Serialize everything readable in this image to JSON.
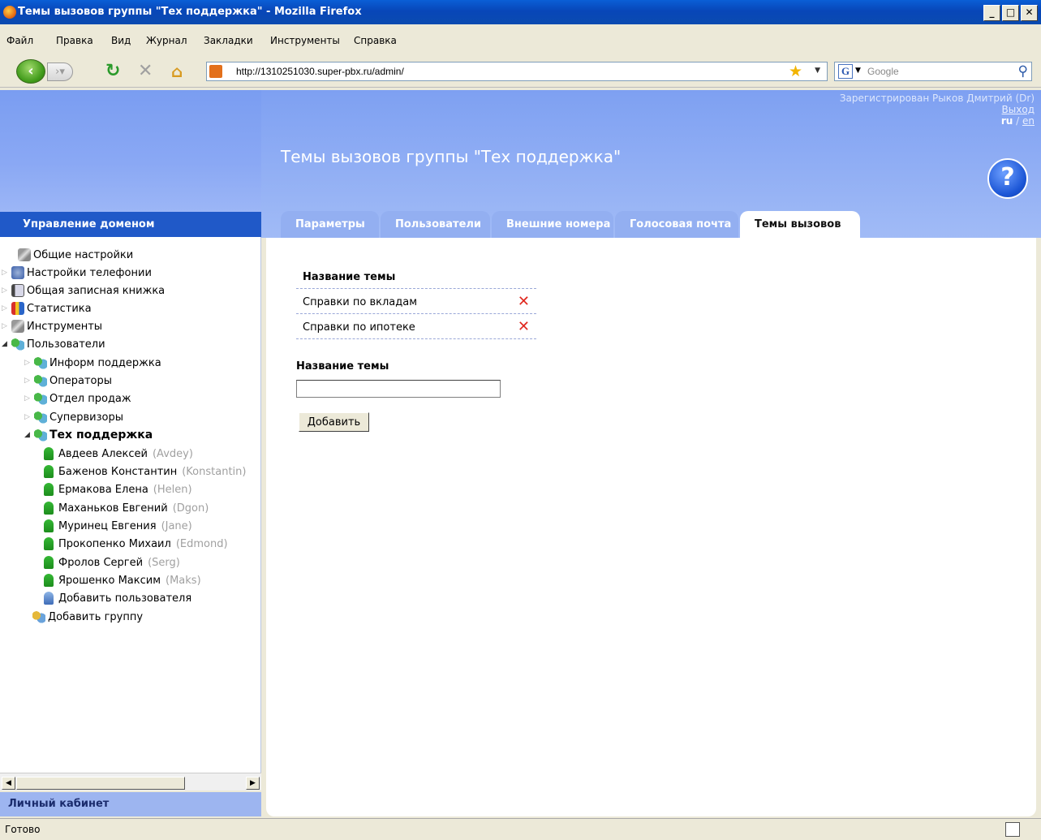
{
  "window": {
    "title": "Темы вызовов группы \"Тех поддержка\" - Mozilla Firefox"
  },
  "menu": [
    "Файл",
    "Правка",
    "Вид",
    "Журнал",
    "Закладки",
    "Инструменты",
    "Справка"
  ],
  "nav": {
    "url": "http://1310251030.super-pbx.ru/admin/",
    "search_placeholder": "Google"
  },
  "header": {
    "registered_text": "Зарегистрирован Рыков Дмитрий (Dr)",
    "logout": "Выход",
    "lang_ru": "ru",
    "lang_sep": "/",
    "lang_en": "en",
    "page_title": "Темы вызовов группы \"Тех поддержка\"",
    "help": "?"
  },
  "tabs": [
    "Параметры",
    "Пользователи",
    "Внешние номера",
    "Голосовая почта",
    "Темы вызовов"
  ],
  "sidebar": {
    "title": "Управление доменом",
    "footer": "Личный кабинет",
    "tree": [
      {
        "label": "Общие настройки",
        "icon": "tools-icon"
      },
      {
        "label": "Настройки телефонии",
        "icon": "phone-icon"
      },
      {
        "label": "Общая записная книжка",
        "icon": "address-book-icon"
      },
      {
        "label": "Статистика",
        "icon": "statistics-icon"
      },
      {
        "label": "Инструменты",
        "icon": "tools-icon"
      },
      {
        "label": "Пользователи",
        "icon": "users-icon"
      },
      {
        "label": "Информ поддержка",
        "icon": "group-icon"
      },
      {
        "label": "Операторы",
        "icon": "group-icon"
      },
      {
        "label": "Отдел продаж",
        "icon": "group-icon"
      },
      {
        "label": "Супервизоры",
        "icon": "group-icon"
      },
      {
        "label": "Тех поддержка",
        "icon": "group-icon"
      }
    ],
    "users": [
      {
        "name": "Авдеев Алексей",
        "login": "(Avdey)"
      },
      {
        "name": "Баженов Константин",
        "login": "(Konstantin)"
      },
      {
        "name": "Ермакова Елена",
        "login": "(Helen)"
      },
      {
        "name": "Маханьков Евгений",
        "login": "(Dgon)"
      },
      {
        "name": "Муринец Евгения",
        "login": "(Jane)"
      },
      {
        "name": "Прокопенко Михаил",
        "login": "(Edmond)"
      },
      {
        "name": "Фролов Сергей",
        "login": "(Serg)"
      },
      {
        "name": "Ярошенко Максим",
        "login": "(Maks)"
      }
    ],
    "add_user": "Добавить пользователя",
    "add_group": "Добавить группу"
  },
  "topics": {
    "column_header": "Название темы",
    "rows": [
      "Справки по вкладам",
      "Справки по ипотеке"
    ],
    "delete_glyph": "✕"
  },
  "form": {
    "label": "Название темы",
    "input_value": "",
    "add_button": "Добавить"
  },
  "status": {
    "text": "Готово"
  }
}
